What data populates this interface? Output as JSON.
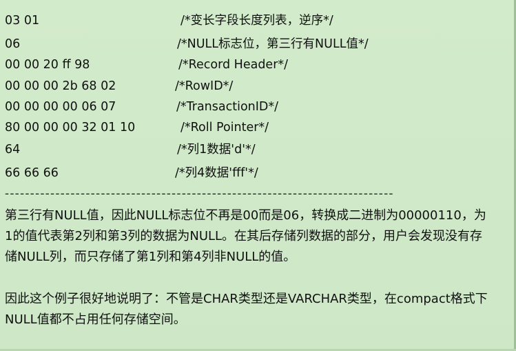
{
  "code_lines": [
    {
      "hex": "03 01",
      "comment": "/*变长字段长度列表，逆序*/"
    },
    {
      "hex": "06",
      "comment": "/*NULL标志位，第三行有NULL值*/"
    },
    {
      "hex": "00 00 20 ff 98",
      "comment": "/*Record Header*/"
    },
    {
      "hex": "00 00 00 2b 68 02",
      "comment": "/*RowID*/"
    },
    {
      "hex": "00 00 00 00 06 07",
      "comment": "/*TransactionID*/"
    },
    {
      "hex": "80 00 00 00 32 01 10",
      "comment": "/*Roll Pointer*/"
    },
    {
      "hex": "64",
      "comment": "/*列1数据'd'*/"
    },
    {
      "hex": "66 66 66",
      "comment": "/*列4数据'fff'*/"
    }
  ],
  "divider": "--------------------------------------------------------------------------------------------------------",
  "paragraph1": {
    "lines": [
      "第三行有NULL值，因此NULL标志位不再是00而是06，转换成二进制为00000110，为",
      "1的值代表第2列和第3列的数据为NULL。在其后存储列数据的部分，用户会发现没有存",
      "储NULL列，而只存储了第1列和第4列非NULL的值。"
    ]
  },
  "paragraph2": {
    "lines": [
      "因此这个例子很好地说明了：不管是CHAR类型还是VARCHAR类型，在compact格式下",
      "NULL值都不占用任何存储空间。"
    ]
  }
}
